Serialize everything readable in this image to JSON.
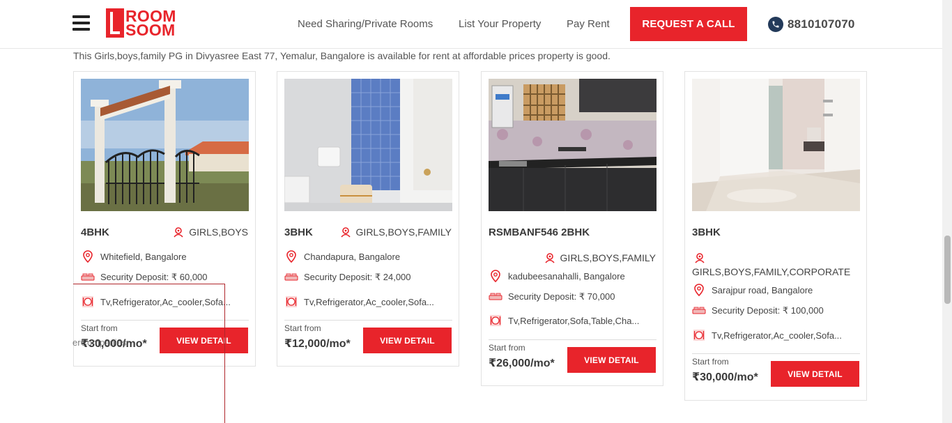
{
  "header": {
    "logo_line1": "ROOM",
    "logo_line2": "SOOM",
    "nav": [
      {
        "label": "Need Sharing/Private Rooms"
      },
      {
        "label": "List Your Property"
      },
      {
        "label": "Pay Rent"
      }
    ],
    "request_label": "REQUEST A CALL",
    "phone": "8810107070"
  },
  "intro": "This Girls,boys,family PG in Divyasree East 77, Yemalur, Bangalore is available for rent at affordable prices property is good.",
  "colors": {
    "accent": "#e8242b",
    "phone_icon_bg": "#233a5a"
  },
  "cards": [
    {
      "title": "4BHK",
      "tags": "GIRLS,BOYS",
      "location": "Whitefield, Bangalore",
      "deposit": "Security Deposit: ₹ 60,000",
      "amenities": "Tv,Refrigerator,Ac_cooler,Sofa...",
      "start_label": "Start from",
      "price": "₹30,000/mo*",
      "button": "VIEW DETAIL"
    },
    {
      "title": "3BHK",
      "tags": "GIRLS,BOYS,FAMILY",
      "location": "Chandapura, Bangalore",
      "deposit": "Security Deposit: ₹ 24,000",
      "amenities": "Tv,Refrigerator,Ac_cooler,Sofa...",
      "start_label": "Start from",
      "price": "₹12,000/mo*",
      "button": "VIEW DETAIL"
    },
    {
      "title": "RSMBANF546 2BHK",
      "tags": "GIRLS,BOYS,FAMILY",
      "location": "kadubeesanahalli, Bangalore",
      "deposit": "Security Deposit: ₹ 70,000",
      "amenities": "Tv,Refrigerator,Sofa,Table,Cha...",
      "start_label": "Start from",
      "price": "₹26,000/mo*",
      "button": "VIEW DETAIL"
    },
    {
      "title": "3BHK",
      "tags": "GIRLS,BOYS,FAMILY,CORPORATE",
      "location": "Sarajpur road, Bangalore",
      "deposit": "Security Deposit: ₹ 100,000",
      "amenities": "Tv,Refrigerator,Ac_cooler,Sofa...",
      "start_label": "Start from",
      "price": "₹30,000/mo*",
      "button": "VIEW DETAIL"
    }
  ],
  "ghost_text": "erCompaniesr"
}
